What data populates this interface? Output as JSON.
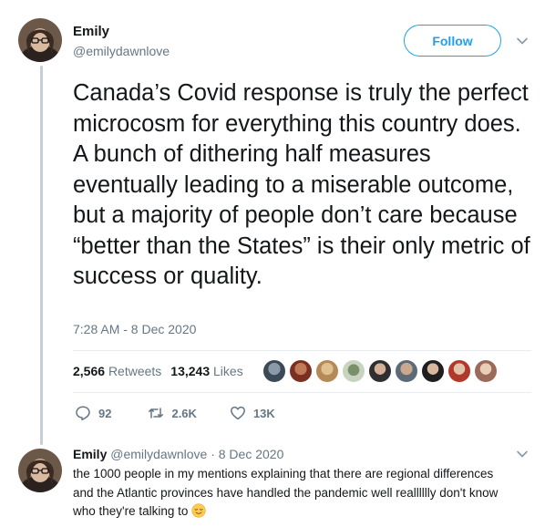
{
  "tweet": {
    "author_name": "Emily",
    "author_handle": "@emilydawnlove",
    "follow_label": "Follow",
    "text": "Canada’s Covid response is truly the perfect microcosm for everything this country does. A bunch of dithering half measures eventually leading to a miserable outcome, but a majority of people don’t care because “better than the States” is their only metric of success or quality.",
    "timestamp": "7:28 AM - 8 Dec 2020",
    "retweets_count": "2,566",
    "retweets_label": "Retweets",
    "likes_count": "13,243",
    "likes_label": "Likes",
    "likers_count": 9,
    "actions": {
      "reply_count": "92",
      "retweet_count": "2.6K",
      "like_count": "13K"
    }
  },
  "reply": {
    "author_name": "Emily",
    "author_handle": "@emilydawnlove",
    "separator": "·",
    "date": "8 Dec 2020",
    "text": "the 1000 people in my mentions explaining that there are regional differences and the Atlantic provinces have handled the pandemic well realllllly don't know who they're talking to",
    "emoji": "relieved-face-emoji"
  },
  "colors": {
    "accent": "#1da1f2",
    "muted": "#657786",
    "text": "#14171a",
    "thread_line": "#c4cfd6"
  },
  "icons": [
    "chevron-down-icon",
    "reply-icon",
    "retweet-icon",
    "like-icon"
  ]
}
